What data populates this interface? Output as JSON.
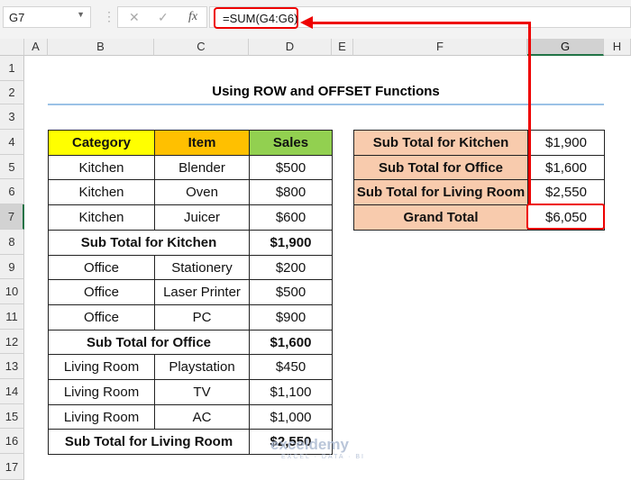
{
  "name_box": "G7",
  "formula": "=SUM(G4:G6)",
  "columns": [
    "A",
    "B",
    "C",
    "D",
    "E",
    "F",
    "G",
    "H"
  ],
  "rows": [
    "1",
    "2",
    "3",
    "4",
    "5",
    "6",
    "7",
    "8",
    "9",
    "10",
    "11",
    "12",
    "13",
    "14",
    "15",
    "16",
    "17"
  ],
  "title": "Using ROW and OFFSET Functions",
  "left_table": {
    "headers": [
      "Category",
      "Item",
      "Sales"
    ],
    "rows": [
      {
        "cat": "Kitchen",
        "item": "Blender",
        "sales": "$500"
      },
      {
        "cat": "Kitchen",
        "item": "Oven",
        "sales": "$800"
      },
      {
        "cat": "Kitchen",
        "item": "Juicer",
        "sales": "$600"
      },
      {
        "sub": "Sub Total for Kitchen",
        "sales": "$1,900"
      },
      {
        "cat": "Office",
        "item": "Stationery",
        "sales": "$200"
      },
      {
        "cat": "Office",
        "item": "Laser Printer",
        "sales": "$500"
      },
      {
        "cat": "Office",
        "item": "PC",
        "sales": "$900"
      },
      {
        "sub": "Sub Total for Office",
        "sales": "$1,600"
      },
      {
        "cat": "Living Room",
        "item": "Playstation",
        "sales": "$450"
      },
      {
        "cat": "Living Room",
        "item": "TV",
        "sales": "$1,100"
      },
      {
        "cat": "Living Room",
        "item": "AC",
        "sales": "$1,000"
      },
      {
        "sub": "Sub Total for Living Room",
        "sales": "$2,550"
      }
    ]
  },
  "right_table": [
    {
      "label": "Sub Total for Kitchen",
      "value": "$1,900"
    },
    {
      "label": "Sub Total for Office",
      "value": "$1,600"
    },
    {
      "label": "Sub Total for Living Room",
      "value": "$2,550"
    },
    {
      "label": "Grand Total",
      "value": "$6,050"
    }
  ],
  "watermark": "exceldemy",
  "watermark_sub": "EXCEL · DATA · BI",
  "colors": {
    "category": "#FFFF00",
    "item": "#FFC000",
    "sales": "#92D050",
    "summary": "#F8CBAD",
    "highlight": "#E00000"
  }
}
